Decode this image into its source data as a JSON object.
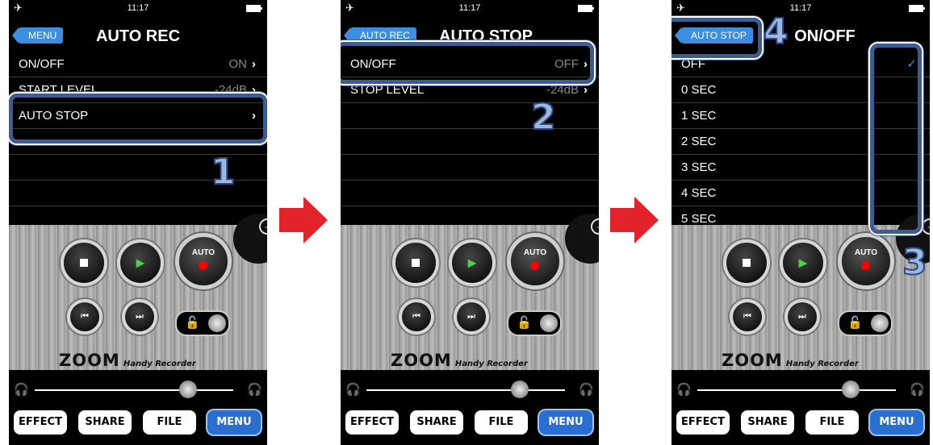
{
  "status_time": "11:17",
  "transport_rec_label": "AUTO",
  "brand": {
    "logo": "ZOOM",
    "tagline": "Handy Recorder"
  },
  "tabs": [
    "EFFECT",
    "SHARE",
    "FILE",
    "MENU"
  ],
  "screen1": {
    "back": "MENU",
    "title": "AUTO REC",
    "rows": [
      {
        "label": "ON/OFF",
        "value": "ON"
      },
      {
        "label": "START LEVEL",
        "value": "-24dB"
      },
      {
        "label": "AUTO STOP",
        "value": ""
      }
    ],
    "step": "1"
  },
  "screen2": {
    "back": "AUTO REC",
    "title": "AUTO STOP",
    "rows": [
      {
        "label": "ON/OFF",
        "value": "OFF"
      },
      {
        "label": "STOP LEVEL",
        "value": "-24dB"
      }
    ],
    "step": "2"
  },
  "screen3": {
    "back": "AUTO STOP",
    "title": "ON/OFF",
    "options": [
      "OFF",
      "0 SEC",
      "1 SEC",
      "2 SEC",
      "3 SEC",
      "4 SEC",
      "5 SEC"
    ],
    "selected": "OFF",
    "steps": [
      "3",
      "4"
    ]
  },
  "colors": {
    "accent": "#3b8ee0",
    "callout": "#3f5c90",
    "arrow": "#e32229"
  },
  "icons": [
    "airplane-icon",
    "battery-icon",
    "chevron-right-icon",
    "checkmark-icon",
    "stop-icon",
    "play-icon",
    "rewind-icon",
    "fast-forward-icon",
    "lock-icon",
    "headphone-icon",
    "arrow-right-icon"
  ]
}
